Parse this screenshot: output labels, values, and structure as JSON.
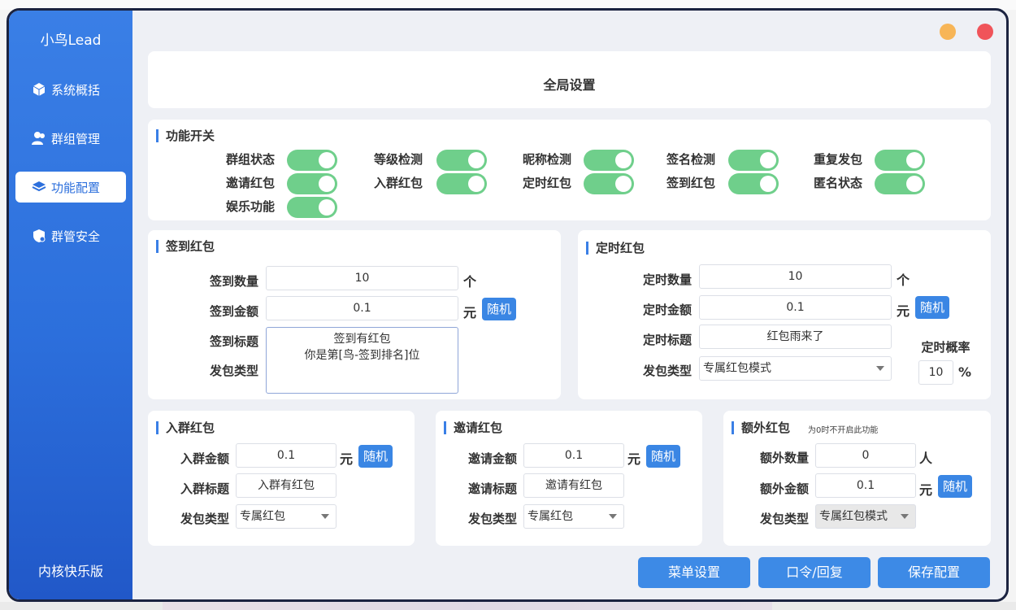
{
  "app": {
    "brand": "小鸟Lead",
    "edition": "内核快乐版"
  },
  "sidebar": {
    "items": [
      {
        "label": "系统概括",
        "icon": "cube-icon"
      },
      {
        "label": "群组管理",
        "icon": "users-icon"
      },
      {
        "label": "功能配置",
        "icon": "layers-icon",
        "active": true
      },
      {
        "label": "群管安全",
        "icon": "shield-icon"
      }
    ]
  },
  "window_controls": {
    "minimize_color": "#f7b557",
    "close_color": "#f0545a"
  },
  "header": {
    "title": "全局设置"
  },
  "features": {
    "title": "功能开关",
    "switches": [
      {
        "label": "群组状态",
        "on": true
      },
      {
        "label": "等级检测",
        "on": true
      },
      {
        "label": "昵称检测",
        "on": true
      },
      {
        "label": "签名检测",
        "on": true
      },
      {
        "label": "重复发包",
        "on": true
      },
      {
        "label": "邀请红包",
        "on": true
      },
      {
        "label": "入群红包",
        "on": true
      },
      {
        "label": "定时红包",
        "on": true
      },
      {
        "label": "签到红包",
        "on": true
      },
      {
        "label": "匿名状态",
        "on": true
      },
      {
        "label": "娱乐功能",
        "on": true
      }
    ]
  },
  "checkin": {
    "title": "签到红包",
    "count_label": "签到数量",
    "count_value": "10",
    "count_unit": "个",
    "amount_label": "签到金额",
    "amount_value": "0.1",
    "amount_unit": "元",
    "random": "随机",
    "title_label": "签到标题",
    "type_label": "发包类型",
    "message_line1": "签到有红包",
    "message_line2": "你是第[鸟-签到排名]位"
  },
  "timed": {
    "title": "定时红包",
    "count_label": "定时数量",
    "count_value": "10",
    "count_unit": "个",
    "amount_label": "定时金额",
    "amount_value": "0.1",
    "amount_unit": "元",
    "random": "随机",
    "title_label": "定时标题",
    "title_value": "红包雨来了",
    "type_label": "发包类型",
    "type_value": "专属红包模式",
    "prob_label": "定时概率",
    "prob_value": "10",
    "prob_unit": "%"
  },
  "join": {
    "title": "入群红包",
    "amount_label": "入群金额",
    "amount_value": "0.1",
    "amount_unit": "元",
    "random": "随机",
    "title_label": "入群标题",
    "title_value": "入群有红包",
    "type_label": "发包类型",
    "type_value": "专属红包"
  },
  "invite": {
    "title": "邀请红包",
    "amount_label": "邀请金额",
    "amount_value": "0.1",
    "amount_unit": "元",
    "random": "随机",
    "title_label": "邀请标题",
    "title_value": "邀请有红包",
    "type_label": "发包类型",
    "type_value": "专属红包"
  },
  "extra": {
    "title": "额外红包",
    "note": "为0时不开启此功能",
    "count_label": "额外数量",
    "count_value": "0",
    "count_unit": "人",
    "amount_label": "额外金额",
    "amount_value": "0.1",
    "amount_unit": "元",
    "random": "随机",
    "type_label": "发包类型",
    "type_value": "专属红包模式"
  },
  "actions": {
    "menu": "菜单设置",
    "password": "口令/回复",
    "save": "保存配置"
  }
}
